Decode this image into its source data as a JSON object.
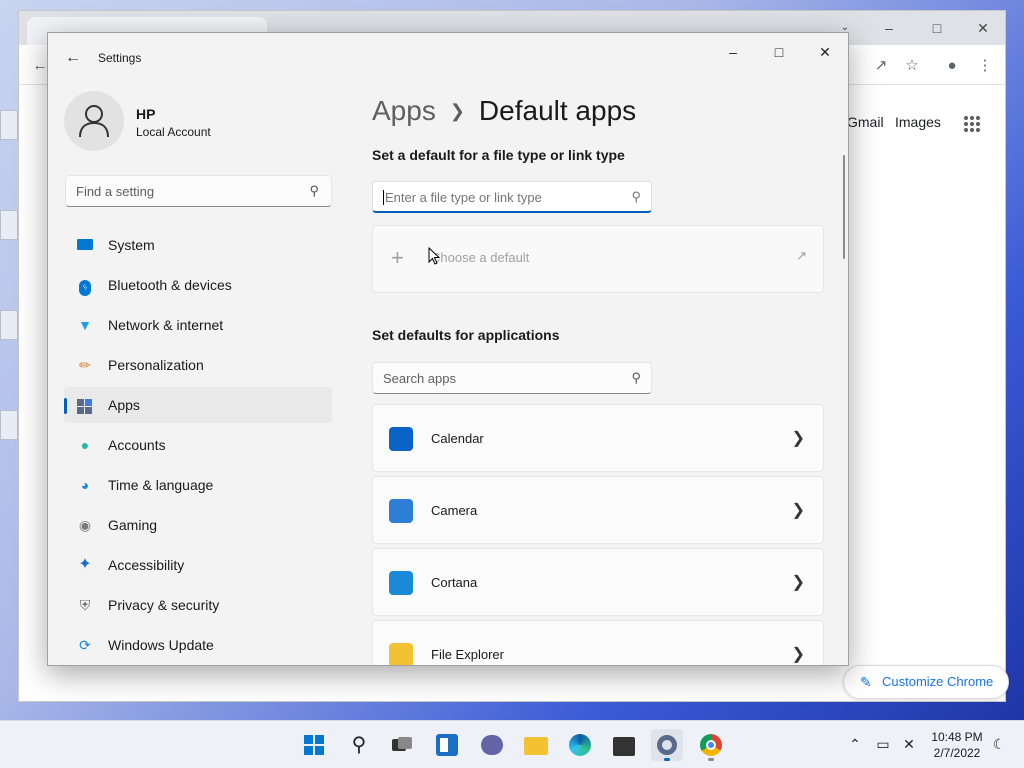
{
  "chrome": {
    "gmail_label": "Gmail",
    "images_label": "Images",
    "customize_label": "Customize Chrome",
    "minimize_icon": "minimize-icon",
    "maximize_icon": "maximize-icon",
    "close_icon": "close-icon"
  },
  "settings": {
    "title": "Settings",
    "profile": {
      "name": "HP",
      "account_type": "Local Account"
    },
    "search_placeholder": "Find a setting",
    "nav": [
      {
        "label": "System",
        "icon": "system-icon",
        "color": "#0078d4"
      },
      {
        "label": "Bluetooth & devices",
        "icon": "bluetooth-icon",
        "color": "#0078d4"
      },
      {
        "label": "Network & internet",
        "icon": "wifi-icon",
        "color": "#1aa0e8"
      },
      {
        "label": "Personalization",
        "icon": "brush-icon",
        "color": "#d67f2f"
      },
      {
        "label": "Apps",
        "icon": "apps-icon",
        "color": "#5a6a8a",
        "selected": true
      },
      {
        "label": "Accounts",
        "icon": "person-icon",
        "color": "#2bb3a4"
      },
      {
        "label": "Time & language",
        "icon": "globe-clock-icon",
        "color": "#1a8ad6"
      },
      {
        "label": "Gaming",
        "icon": "gamepad-icon",
        "color": "#7a7a7a"
      },
      {
        "label": "Accessibility",
        "icon": "accessibility-icon",
        "color": "#1a6fc4"
      },
      {
        "label": "Privacy & security",
        "icon": "shield-icon",
        "color": "#6d6d6d"
      },
      {
        "label": "Windows Update",
        "icon": "update-icon",
        "color": "#1a8ad6"
      }
    ],
    "breadcrumb": {
      "parent": "Apps",
      "current": "Default apps"
    },
    "filetype_section_title": "Set a default for a file type or link type",
    "filetype_placeholder": "Enter a file type or link type",
    "choose_default_label": "Choose a default",
    "apps_section_title": "Set defaults for applications",
    "apps_search_placeholder": "Search apps",
    "apps": [
      {
        "name": "Calendar",
        "icon": "calendar-icon",
        "color": "#0a64c8"
      },
      {
        "name": "Camera",
        "icon": "camera-icon",
        "color": "#2d7fd6"
      },
      {
        "name": "Cortana",
        "icon": "cortana-icon",
        "color": "#1a8ad6"
      },
      {
        "name": "File Explorer",
        "icon": "folder-icon",
        "color": "#f2c232"
      }
    ]
  },
  "taskbar": {
    "items": [
      "start-icon",
      "search-icon",
      "task-view-icon",
      "widgets-icon",
      "teams-chat-icon",
      "file-explorer-icon",
      "edge-icon",
      "store-icon",
      "settings-icon",
      "chrome-icon"
    ],
    "time": "10:48 PM",
    "date": "2/7/2022"
  }
}
